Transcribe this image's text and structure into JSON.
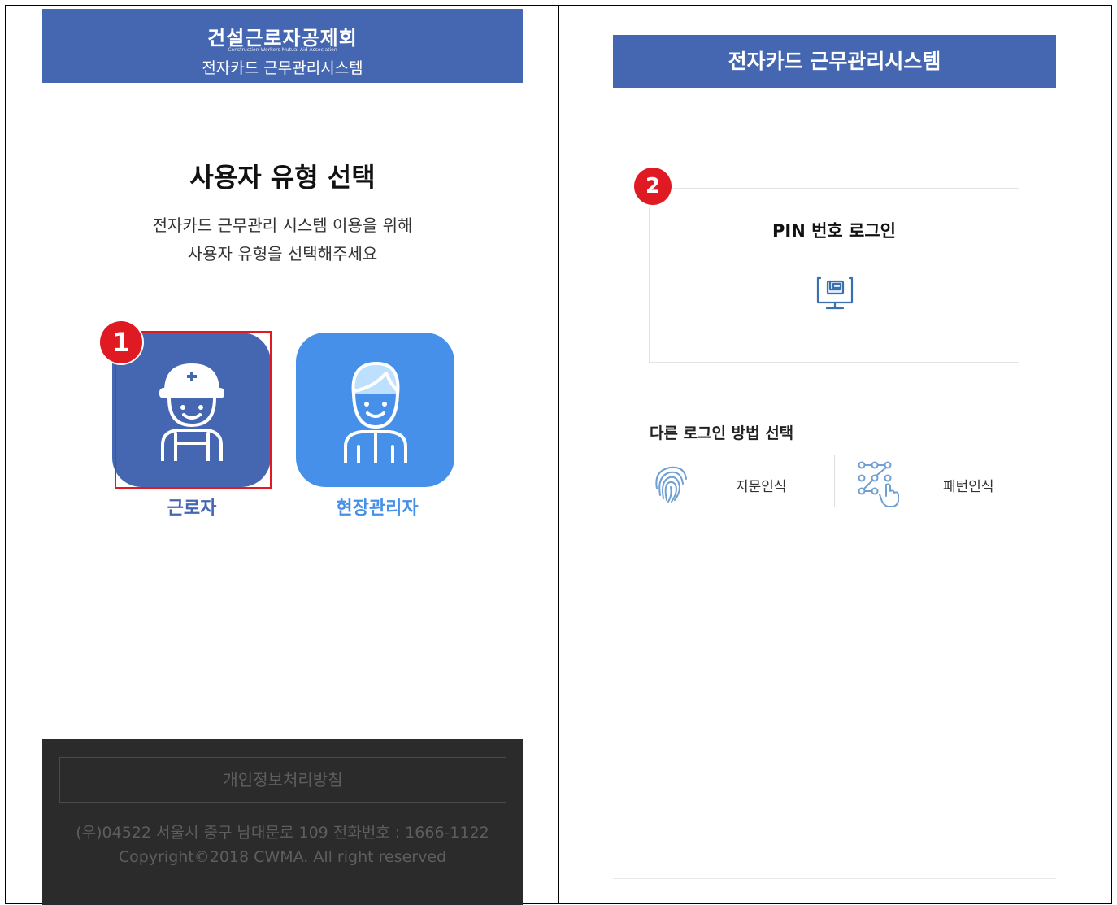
{
  "left": {
    "header": {
      "org_name": "건설근로자공제회",
      "org_name_en": "Construction Workers Mutual Aid Association",
      "system_name": "전자카드 근무관리시스템"
    },
    "title": "사용자 유형 선택",
    "description_line1": "전자카드 근무관리 시스템 이용을 위해",
    "description_line2": "사용자 유형을 선택해주세요",
    "badge": "1",
    "worker_label": "근로자",
    "manager_label": "현장관리자",
    "footer": {
      "privacy": "개인정보처리방침",
      "address": "(우)04522 서울시 중구 남대문로 109 전화번호 : 1666-1122",
      "copyright": "Copyright©2018 CWMA. All right reserved"
    }
  },
  "right": {
    "header": {
      "title": "전자카드 근무관리시스템"
    },
    "badge": "2",
    "pin_login": "PIN 번호 로그인",
    "other_methods_title": "다른 로그인 방법 선택",
    "fingerprint_label": "지문인식",
    "pattern_label": "패턴인식"
  },
  "colors": {
    "header_blue": "#4567b1",
    "manager_blue": "#4690ea",
    "highlight_red": "#e01a22",
    "footer_dark": "#2b2b2b"
  },
  "icons": [
    "worker-hardhat-icon",
    "manager-icon",
    "pin-monitor-icon",
    "fingerprint-icon",
    "pattern-icon"
  ]
}
